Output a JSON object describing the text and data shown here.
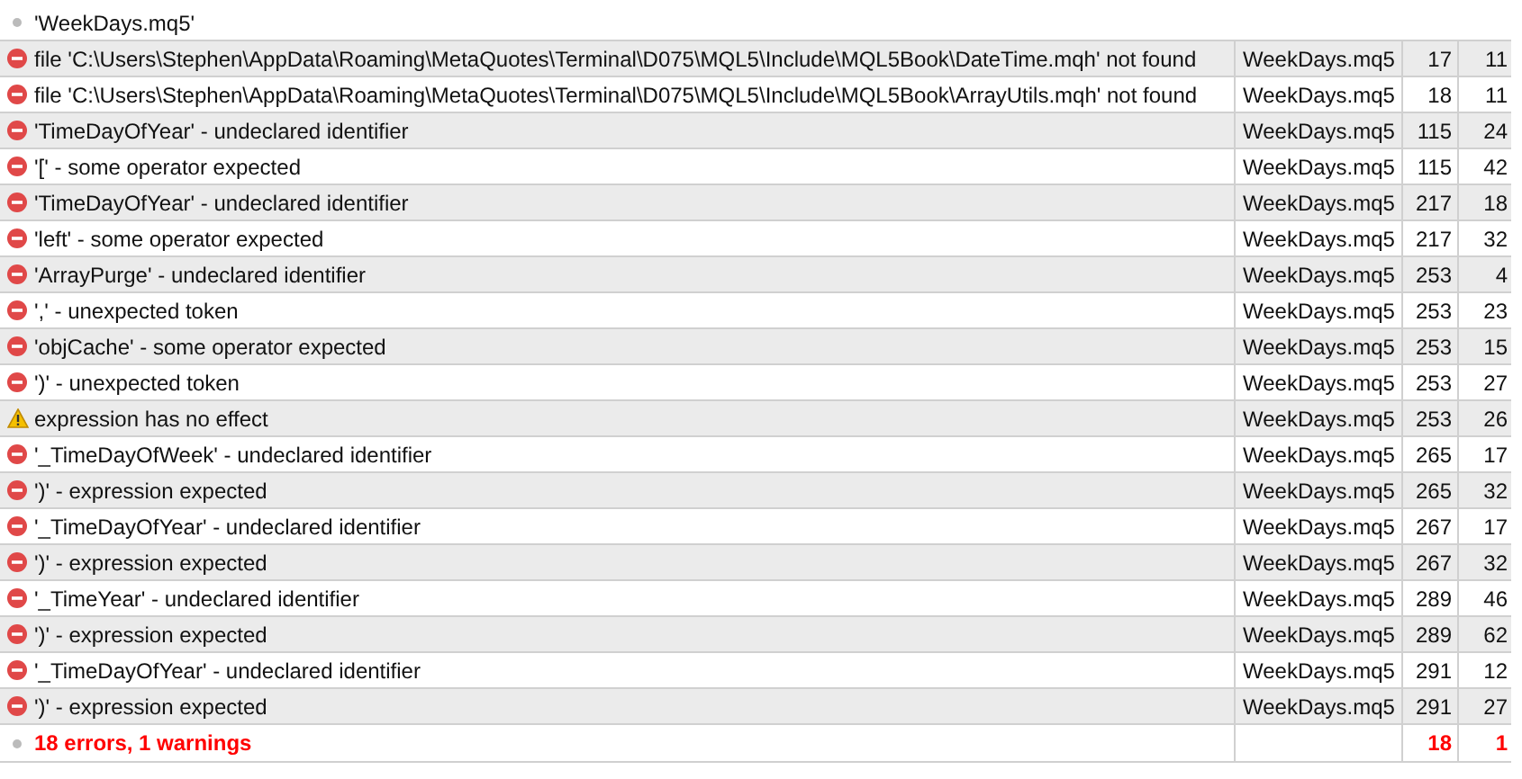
{
  "header": {
    "kind": "info",
    "message": "'WeekDays.mq5'"
  },
  "rows": [
    {
      "kind": "error",
      "message": "file 'C:\\Users\\Stephen\\AppData\\Roaming\\MetaQuotes\\Terminal\\D075\\MQL5\\Include\\MQL5Book\\DateTime.mqh' not found",
      "file": "WeekDays.mq5",
      "line": "17",
      "column": "11"
    },
    {
      "kind": "error",
      "message": "file 'C:\\Users\\Stephen\\AppData\\Roaming\\MetaQuotes\\Terminal\\D075\\MQL5\\Include\\MQL5Book\\ArrayUtils.mqh' not found",
      "file": "WeekDays.mq5",
      "line": "18",
      "column": "11"
    },
    {
      "kind": "error",
      "message": "'TimeDayOfYear' - undeclared identifier",
      "file": "WeekDays.mq5",
      "line": "115",
      "column": "24"
    },
    {
      "kind": "error",
      "message": "'[' - some operator expected",
      "file": "WeekDays.mq5",
      "line": "115",
      "column": "42"
    },
    {
      "kind": "error",
      "message": "'TimeDayOfYear' - undeclared identifier",
      "file": "WeekDays.mq5",
      "line": "217",
      "column": "18"
    },
    {
      "kind": "error",
      "message": "'left' - some operator expected",
      "file": "WeekDays.mq5",
      "line": "217",
      "column": "32"
    },
    {
      "kind": "error",
      "message": "'ArrayPurge' - undeclared identifier",
      "file": "WeekDays.mq5",
      "line": "253",
      "column": "4"
    },
    {
      "kind": "error",
      "message": "',' - unexpected token",
      "file": "WeekDays.mq5",
      "line": "253",
      "column": "23"
    },
    {
      "kind": "error",
      "message": "'objCache' - some operator expected",
      "file": "WeekDays.mq5",
      "line": "253",
      "column": "15"
    },
    {
      "kind": "error",
      "message": "')' - unexpected token",
      "file": "WeekDays.mq5",
      "line": "253",
      "column": "27"
    },
    {
      "kind": "warning",
      "message": "expression has no effect",
      "file": "WeekDays.mq5",
      "line": "253",
      "column": "26"
    },
    {
      "kind": "error",
      "message": "'_TimeDayOfWeek' - undeclared identifier",
      "file": "WeekDays.mq5",
      "line": "265",
      "column": "17"
    },
    {
      "kind": "error",
      "message": "')' - expression expected",
      "file": "WeekDays.mq5",
      "line": "265",
      "column": "32"
    },
    {
      "kind": "error",
      "message": "'_TimeDayOfYear' - undeclared identifier",
      "file": "WeekDays.mq5",
      "line": "267",
      "column": "17"
    },
    {
      "kind": "error",
      "message": "')' - expression expected",
      "file": "WeekDays.mq5",
      "line": "267",
      "column": "32"
    },
    {
      "kind": "error",
      "message": "'_TimeYear' - undeclared identifier",
      "file": "WeekDays.mq5",
      "line": "289",
      "column": "46"
    },
    {
      "kind": "error",
      "message": "')' - expression expected",
      "file": "WeekDays.mq5",
      "line": "289",
      "column": "62"
    },
    {
      "kind": "error",
      "message": "'_TimeDayOfYear' - undeclared identifier",
      "file": "WeekDays.mq5",
      "line": "291",
      "column": "12"
    },
    {
      "kind": "error",
      "message": "')' - expression expected",
      "file": "WeekDays.mq5",
      "line": "291",
      "column": "27"
    }
  ],
  "summary": {
    "kind": "info",
    "message": "18 errors, 1 warnings",
    "errors": "18",
    "warnings": "1"
  }
}
